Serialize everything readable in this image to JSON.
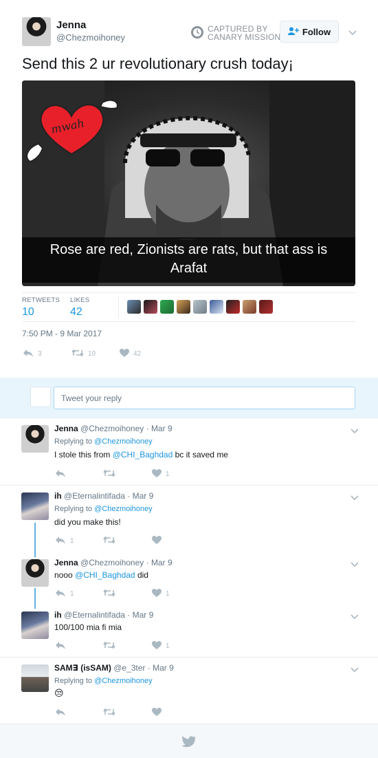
{
  "tweet": {
    "author_name": "Jenna",
    "author_handle": "@Chezmoihoney",
    "captured_label_line1": "CAPTURED BY",
    "captured_label_line2": "CANARY MISSION",
    "follow_label": "Follow",
    "text": "Send this 2 ur revolutionary crush today¡",
    "media": {
      "sticker_text": "mwah",
      "caption_line1": "Rose are red, Zionists are rats, but that ass is",
      "caption_line2": "Arafat"
    },
    "stats": {
      "retweets_label": "RETWEETS",
      "retweets_value": "10",
      "likes_label": "LIKES",
      "likes_value": "42"
    },
    "timestamp": "7:50 PM - 9 Mar 2017",
    "actions": {
      "reply_count": "3",
      "retweet_count": "10",
      "like_count": "42"
    }
  },
  "reply_box": {
    "placeholder": "Tweet your reply"
  },
  "replies": [
    {
      "name": "Jenna",
      "handle": "@Chezmoihoney",
      "date": "· Mar 9",
      "replying_label": "Replying to",
      "replying_to": "@Chezmoihoney",
      "text_before": "I stole this from ",
      "mention": "@CHI_Baghdad",
      "text_after": " bc it saved me",
      "reply_count": "",
      "retweet_count": "",
      "like_count": "1"
    },
    {
      "name": "ih",
      "handle": "@Eternalintifada",
      "date": "· Mar 9",
      "replying_label": "Replying to",
      "replying_to": "@Chezmoihoney",
      "text": "did you make this!",
      "reply_count": "1",
      "retweet_count": "",
      "like_count": ""
    },
    {
      "name": "Jenna",
      "handle": "@Chezmoihoney",
      "date": "· Mar 9",
      "text_before": "nooo ",
      "mention": "@CHI_Baghdad",
      "text_after": " did",
      "reply_count": "1",
      "retweet_count": "",
      "like_count": "1"
    },
    {
      "name": "ih",
      "handle": "@Eternalintifada",
      "date": "· Mar 9",
      "text": "100/100 mia fi mia",
      "reply_count": "",
      "retweet_count": "",
      "like_count": "1"
    },
    {
      "name": "SAM∃ (isSAM)",
      "handle": "@e_3ter",
      "date": "· Mar 9",
      "replying_label": "Replying to",
      "replying_to": "@Chezmoihoney",
      "text": "😒",
      "reply_count": "",
      "retweet_count": "",
      "like_count": ""
    }
  ],
  "colors": {
    "link": "#1b95e0",
    "icon_grey": "#aab8c2",
    "reply_bar": "#e8f5fd",
    "thread_line": "#5fb0e6"
  },
  "icons": [
    "canary-mission-icon",
    "add-user-icon",
    "chevron-down-icon",
    "reply-icon",
    "retweet-icon",
    "heart-icon",
    "twitter-bird-icon"
  ]
}
